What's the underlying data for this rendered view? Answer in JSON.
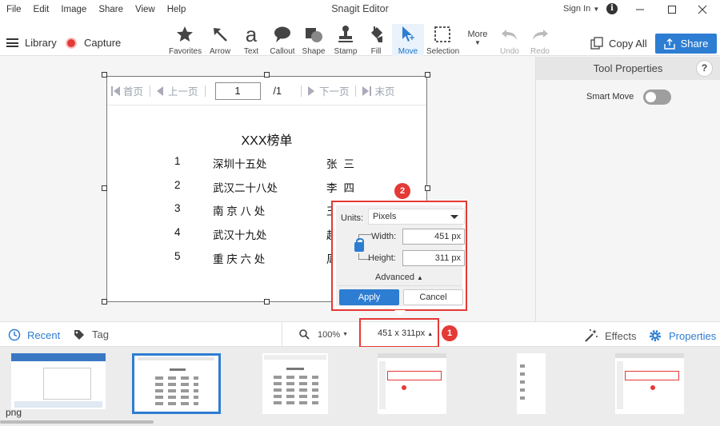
{
  "menu": {
    "items": [
      "File",
      "Edit",
      "Image",
      "Share",
      "View",
      "Help"
    ]
  },
  "window": {
    "title": "Snagit Editor",
    "signin": "Sign In",
    "info_glyph": "i"
  },
  "toolbar": {
    "library": "Library",
    "capture": "Capture",
    "tools": [
      {
        "label": "Favorites",
        "icon": "star-icon"
      },
      {
        "label": "Arrow",
        "icon": "arrow-icon"
      },
      {
        "label": "Text",
        "icon": "text-icon",
        "glyph": "a"
      },
      {
        "label": "Callout",
        "icon": "callout-icon"
      },
      {
        "label": "Shape",
        "icon": "shape-icon"
      },
      {
        "label": "Stamp",
        "icon": "stamp-icon"
      },
      {
        "label": "Fill",
        "icon": "fill-icon"
      },
      {
        "label": "Move",
        "icon": "move-icon",
        "active": true
      },
      {
        "label": "Selection",
        "icon": "selection-icon"
      },
      {
        "label": "More",
        "icon": "chevron-down-icon"
      },
      {
        "label": "Undo",
        "icon": "undo-icon",
        "disabled": true
      },
      {
        "label": "Redo",
        "icon": "redo-icon",
        "disabled": true
      }
    ],
    "copy_all": "Copy All",
    "share": "Share"
  },
  "tool_properties": {
    "title": "Tool Properties",
    "help_glyph": "?",
    "smart_move_label": "Smart Move",
    "smart_move_on": false
  },
  "document": {
    "pager": {
      "first": "首页",
      "prev": "上一页",
      "page_value": "1",
      "total": "/1",
      "next": "下一页",
      "last": "末页"
    },
    "title": "XXX榜单",
    "rows": [
      {
        "num": "1",
        "name": "深圳十五处",
        "person": "张三"
      },
      {
        "num": "2",
        "name": "武汉二十八处",
        "person": "李四"
      },
      {
        "num": "3",
        "name": "南 京 八 处",
        "person": "王"
      },
      {
        "num": "4",
        "name": "武汉十九处",
        "person": "赵"
      },
      {
        "num": "5",
        "name": "重 庆 六 处",
        "person": "周"
      }
    ]
  },
  "resize_popup": {
    "units_label": "Units:",
    "units_value": "Pixels",
    "width_label": "Width:",
    "width_value": "451 px",
    "height_label": "Height:",
    "height_value": "311 px",
    "advanced": "Advanced",
    "apply": "Apply",
    "cancel": "Cancel"
  },
  "badges": {
    "one": "1",
    "two": "2"
  },
  "bottom_bar": {
    "recent": "Recent",
    "tag": "Tag",
    "zoom": "100%",
    "dimensions": "451 x 311px",
    "effects": "Effects",
    "properties": "Properties"
  },
  "tray": {
    "first_thumb_label": "png"
  },
  "colors": {
    "accent": "#2d7dd2",
    "annotation": "#e53935"
  }
}
